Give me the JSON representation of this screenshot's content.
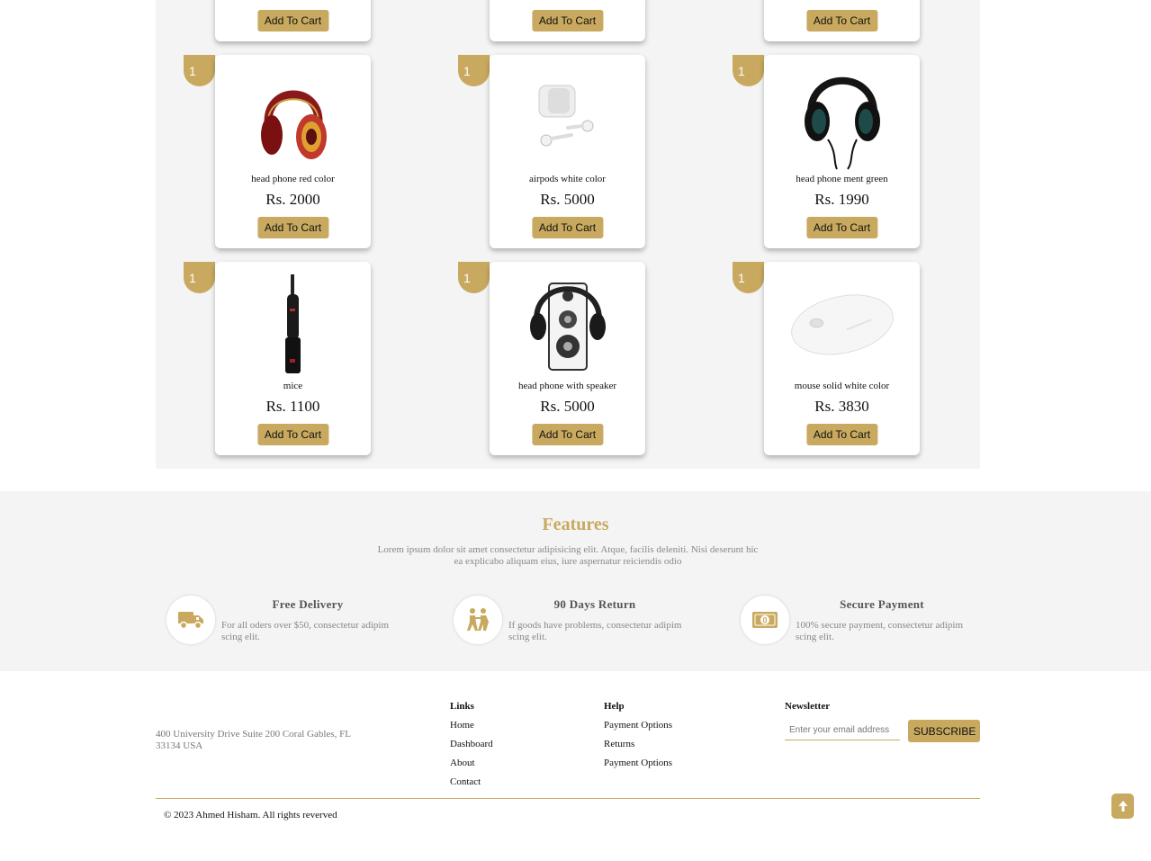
{
  "colors": {
    "accent": "#c8a95f",
    "section_bg": "#f4f4f4",
    "text_dark": "#111111",
    "text_muted": "#888888"
  },
  "products": {
    "add_to_cart_label": "Add To Cart",
    "top_row_partial": [
      {
        "button": "Add To Cart"
      },
      {
        "button": "Add To Cart"
      },
      {
        "button": "Add To Cart"
      }
    ],
    "items": [
      {
        "qty": "1",
        "name": "head phone red color",
        "price": "Rs. 2000",
        "image": "red-headphone-icon"
      },
      {
        "qty": "1",
        "name": "airpods white color",
        "price": "Rs. 5000",
        "image": "airpods-icon"
      },
      {
        "qty": "1",
        "name": "head phone ment green",
        "price": "Rs. 1990",
        "image": "green-headphone-icon"
      },
      {
        "qty": "1",
        "name": "mice",
        "price": "Rs. 1100",
        "image": "microphone-icon"
      },
      {
        "qty": "1",
        "name": "head phone with speaker",
        "price": "Rs. 5000",
        "image": "headphone-speaker-icon"
      },
      {
        "qty": "1",
        "name": "mouse solid white color",
        "price": "Rs. 3830",
        "image": "mouse-icon"
      }
    ]
  },
  "features": {
    "title": "Features",
    "description": "Lorem ipsum dolor sit amet consectetur adipisicing elit. Atque, facilis deleniti. Nisi deserunt hic ea explicabo aliquam eius, iure aspernatur reiciendis odio",
    "items": [
      {
        "icon": "truck-icon",
        "title": "Free Delivery",
        "text": "For all oders over $50, consectetur adipim scing elit."
      },
      {
        "icon": "people-return-icon",
        "title": "90 Days Return",
        "text": "If goods have problems, consectetur adipim scing elit."
      },
      {
        "icon": "money-icon",
        "title": "Secure Payment",
        "text": "100% secure payment, consectetur adipim scing elit."
      }
    ]
  },
  "footer": {
    "address": "400 University Drive Suite 200 Coral Gables, FL 33134 USA",
    "links_heading": "Links",
    "links": [
      "Home",
      "Dashboard",
      "About",
      "Contact"
    ],
    "help_heading": "Help",
    "help_links": [
      "Payment Options",
      "Returns",
      "Payment Options"
    ],
    "newsletter_heading": "Newsletter",
    "newsletter_placeholder": "Enter your email address",
    "subscribe_label": "SUBSCRIBE",
    "copyright": "© 2023 Ahmed Hisham. All rights reverved"
  }
}
